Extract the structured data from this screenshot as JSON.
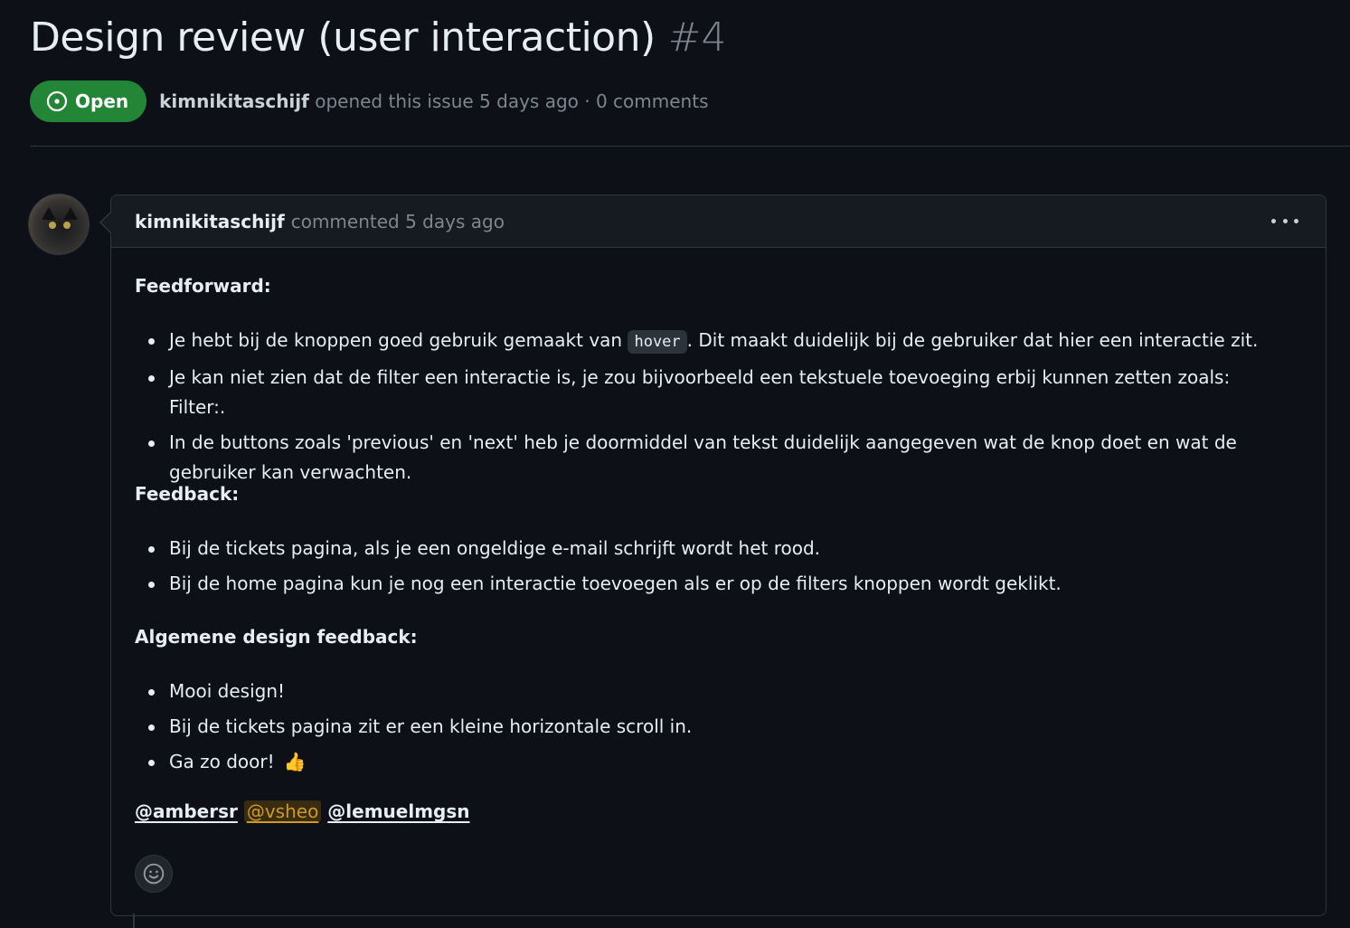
{
  "issue": {
    "title": "Design review (user interaction)",
    "number": "#4",
    "state": "Open",
    "author": "kimnikitaschijf",
    "meta_suffix": " opened this issue 5 days ago · 0 comments"
  },
  "comment": {
    "author": "kimnikitaschijf",
    "time": "commented 5 days ago",
    "sections": [
      {
        "heading": "Feedforward:",
        "items": [
          {
            "before": "Je hebt bij de knoppen goed gebruik gemaakt van ",
            "code": "hover",
            "after": ". Dit maakt duidelijk bij de gebruiker dat hier een interactie zit."
          },
          {
            "text": "Je kan niet zien dat de filter een interactie is, je zou bijvoorbeeld een tekstuele toevoeging erbij kunnen zetten zoals: Filter:."
          },
          {
            "text": "In de buttons zoals 'previous' en 'next' heb je doormiddel van tekst duidelijk aangegeven wat de knop doet en wat de gebruiker kan verwachten."
          }
        ]
      },
      {
        "heading": "Feedback:",
        "items": [
          {
            "text": "Bij de tickets pagina, als je een ongeldige e-mail schrijft wordt het rood."
          },
          {
            "text": "Bij de home pagina kun je nog een interactie toevoegen als er op de filters knoppen wordt geklikt."
          }
        ]
      },
      {
        "heading": "Algemene design feedback:",
        "items": [
          {
            "text": "Mooi design!"
          },
          {
            "text": "Bij de tickets pagina zit er een kleine horizontale scroll in."
          },
          {
            "text": "Ga zo door!",
            "emoji": "👍"
          }
        ]
      }
    ],
    "mentions": [
      "@ambersr",
      "@vsheo",
      "@lemuelmgsn"
    ]
  },
  "icons": {
    "state": "issue-opened-icon",
    "more": "kebab-horizontal-icon",
    "reaction": "smiley-icon"
  },
  "colors": {
    "background": "#0d1117",
    "open_badge": "#238636",
    "mention_highlight": "#d29922"
  }
}
